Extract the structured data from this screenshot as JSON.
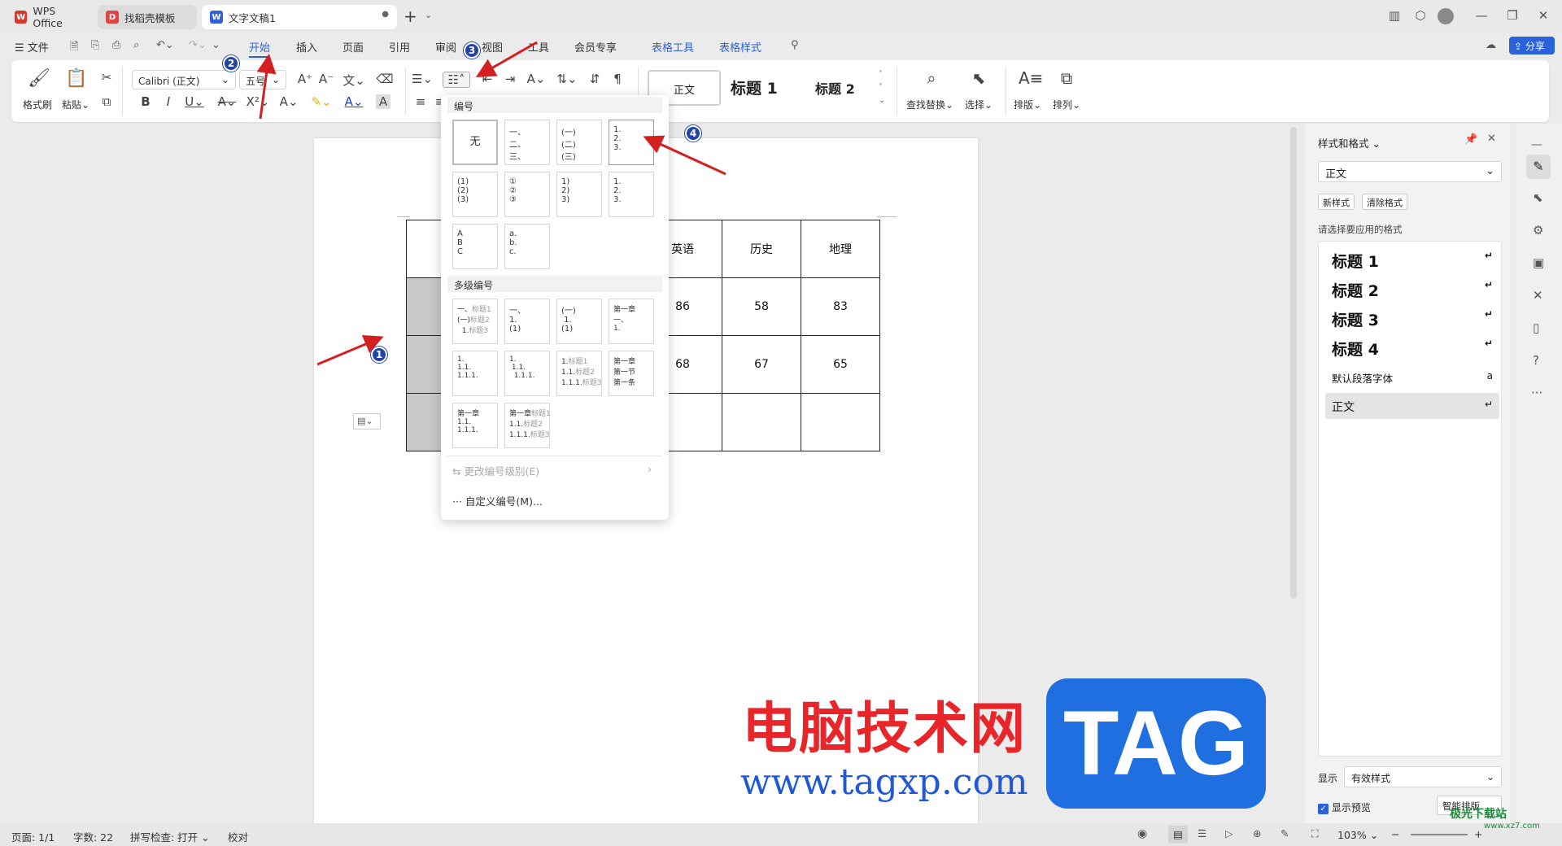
{
  "tabs": {
    "wps": "WPS Office",
    "template": "找稻壳模板",
    "doc": "文字文稿1",
    "new": "+"
  },
  "menu": {
    "file": "文件",
    "start": "开始",
    "insert": "插入",
    "page": "页面",
    "ref": "引用",
    "review": "审阅",
    "view": "视图",
    "tools": "工具",
    "vip": "会员专享",
    "table_tools": "表格工具",
    "table_style": "表格样式",
    "share": "分享"
  },
  "ribbon": {
    "format_painter": "格式刷",
    "paste": "粘贴",
    "font": "Calibri (正文)",
    "size": "五号",
    "style_normal": "正文",
    "style_h1": "标题 1",
    "style_h2": "标题 2",
    "find_replace": "查找替换",
    "select": "选择",
    "layout": "排版",
    "arrange": "排列"
  },
  "dropdown": {
    "numbering": "编号",
    "none": "无",
    "multilevel": "多级编号",
    "change_level": "更改编号级别(E)",
    "custom": "自定义编号(M)..."
  },
  "table": {
    "headers": [
      "英语",
      "历史",
      "地理"
    ],
    "row1": [
      "86",
      "58",
      "83"
    ],
    "row2": [
      "68",
      "67",
      "65"
    ]
  },
  "panel": {
    "title": "样式和格式",
    "current": "正文",
    "new_style": "新样式",
    "clear_format": "清除格式",
    "prompt": "请选择要应用的格式",
    "styles": [
      "标题 1",
      "标题 2",
      "标题 3",
      "标题 4"
    ],
    "default_font": "默认段落字体",
    "normal": "正文",
    "show_label": "显示",
    "show_value": "有效样式",
    "preview": "显示预览",
    "smart": "智能排版"
  },
  "status": {
    "page": "页面: 1/1",
    "words": "字数: 22",
    "spell": "拼写检查: 打开",
    "proof": "校对",
    "zoom": "103%"
  },
  "watermark": {
    "cn": "电脑技术网",
    "url": "www.tagxp.com",
    "tag": "TAG",
    "corner": "极光下载站",
    "corner_url": "www.xz7.com"
  },
  "badges": [
    "1",
    "2",
    "3",
    "4"
  ]
}
